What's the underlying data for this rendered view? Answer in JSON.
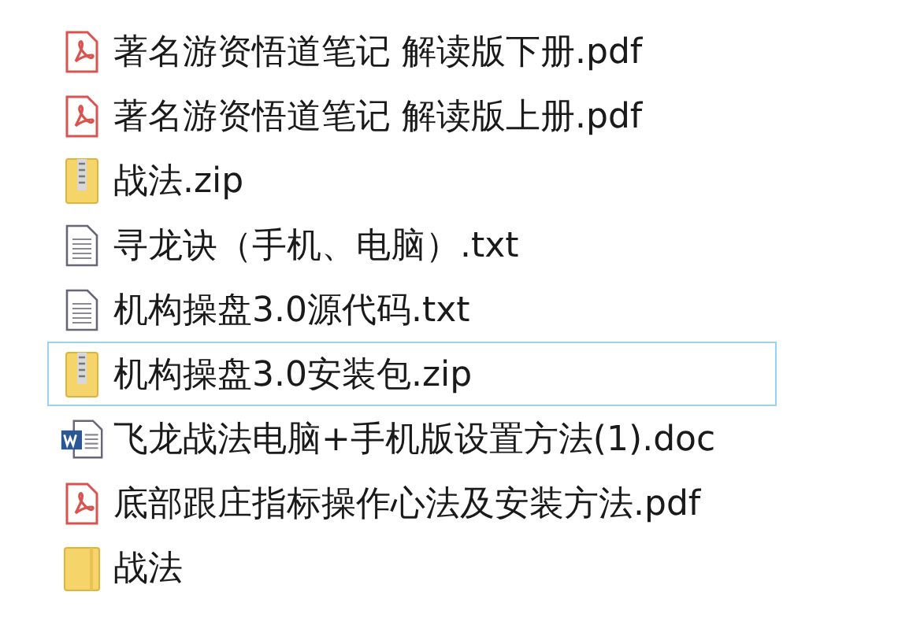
{
  "files": [
    {
      "name": "著名游资悟道笔记 解读版下册.pdf",
      "kind": "pdf",
      "selected": false
    },
    {
      "name": "著名游资悟道笔记 解读版上册.pdf",
      "kind": "pdf",
      "selected": false
    },
    {
      "name": "战法.zip",
      "kind": "zip",
      "selected": false
    },
    {
      "name": "寻龙诀（手机、电脑）.txt",
      "kind": "txt",
      "selected": false
    },
    {
      "name": "机构操盘3.0源代码.txt",
      "kind": "txt",
      "selected": false
    },
    {
      "name": "机构操盘3.0安装包.zip",
      "kind": "zip",
      "selected": true
    },
    {
      "name": "飞龙战法电脑+手机版设置方法(1).doc",
      "kind": "doc",
      "selected": false
    },
    {
      "name": "底部跟庄指标操作心法及安装方法.pdf",
      "kind": "pdf",
      "selected": false
    },
    {
      "name": "战法",
      "kind": "folder",
      "selected": false
    }
  ]
}
